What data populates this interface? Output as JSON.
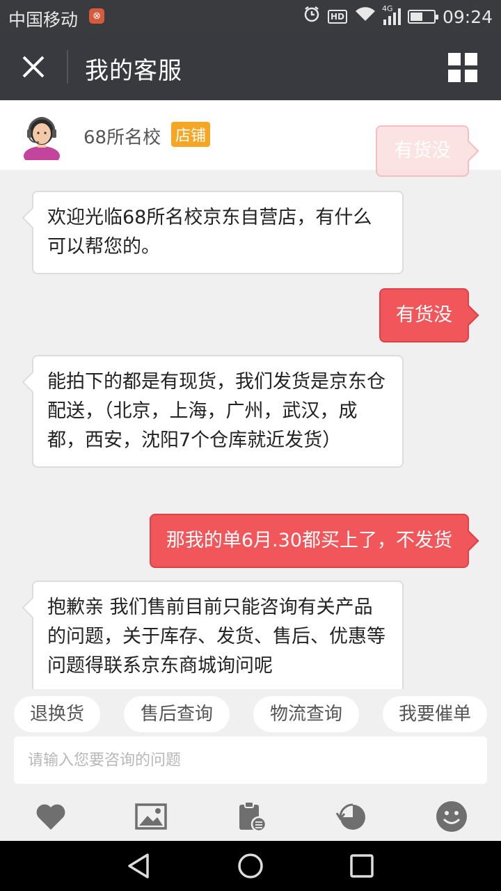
{
  "status_bar": {
    "carrier": "中国移动",
    "network": "4G",
    "hd": "HD",
    "time": "09:24",
    "battery_level": 0.5
  },
  "title_bar": {
    "title": "我的客服",
    "close_icon": "close-icon",
    "menu_icon": "grid-icon"
  },
  "shop": {
    "name": "68所名校",
    "badge": "店铺"
  },
  "messages": [
    {
      "side": "left",
      "text": "欢迎光临68所名校京东自营店，有什么可以帮您的。"
    },
    {
      "side": "right",
      "text": "有货没"
    },
    {
      "side": "left",
      "text": "能拍下的都是有现货，我们发货是京东仓配送，（北京，上海，广州，武汉，成都，西安，沈阳7个仓库就近发货）"
    },
    {
      "side": "right",
      "text": "那我的单6月.30都买上了，不发货"
    },
    {
      "side": "left",
      "text": "抱歉亲 我们售前目前只能咨询有关产品的问题，关于库存、发货、售后、优惠等问题得联系京东商城询问呢"
    }
  ],
  "ghost_message": "有货没",
  "quick_replies": [
    "退换货",
    "售后查询",
    "物流查询",
    "我要催单"
  ],
  "input": {
    "placeholder": "请输入您要咨询的问题",
    "value": ""
  },
  "toolbar_icons": [
    "heart-icon",
    "image-icon",
    "order-clipboard-icon",
    "history-icon",
    "emoji-icon"
  ],
  "colors": {
    "accent": "#f0565a",
    "badge": "#f5a623",
    "header": "#393a3f"
  }
}
